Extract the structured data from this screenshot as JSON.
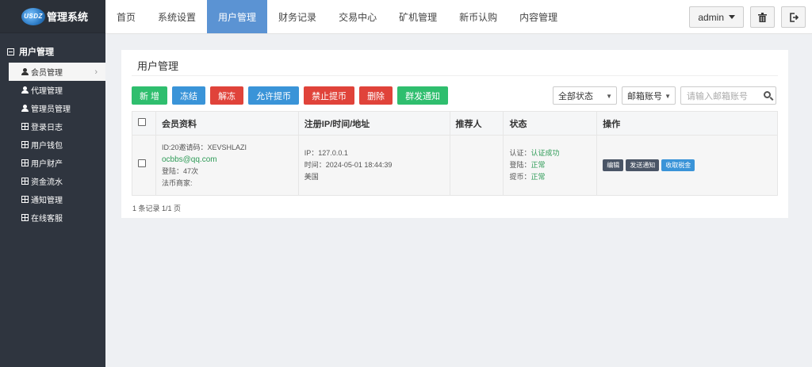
{
  "app": {
    "logo_badge": "USDZ",
    "title": "管理系统"
  },
  "sidebar": {
    "section": "用户管理",
    "items": [
      {
        "label": "会员管理",
        "icon": "person-icon",
        "active": true
      },
      {
        "label": "代理管理",
        "icon": "person-icon"
      },
      {
        "label": "管理员管理",
        "icon": "person-icon"
      },
      {
        "label": "登录日志",
        "icon": "list-icon"
      },
      {
        "label": "用户钱包",
        "icon": "list-icon"
      },
      {
        "label": "用户财产",
        "icon": "list-icon"
      },
      {
        "label": "资金流水",
        "icon": "list-icon"
      },
      {
        "label": "通知管理",
        "icon": "list-icon"
      },
      {
        "label": "在线客服",
        "icon": "list-icon"
      }
    ]
  },
  "topnav": {
    "tabs": [
      "首页",
      "系统设置",
      "用户管理",
      "财务记录",
      "交易中心",
      "矿机管理",
      "新币认购",
      "内容管理"
    ],
    "active_tab": "用户管理",
    "user": "admin"
  },
  "panel": {
    "title": "用户管理",
    "toolbar": {
      "add": "新 增",
      "freeze": "冻结",
      "unfreeze": "解冻",
      "allow_withdraw": "允许提币",
      "forbid_withdraw": "禁止提币",
      "delete": "删除",
      "broadcast": "群发通知"
    },
    "filters": {
      "status": "全部状态",
      "account_type": "邮箱账号",
      "search_placeholder": "请输入邮箱账号"
    },
    "table": {
      "headers": [
        "会员资料",
        "注册IP/时间/地址",
        "推荐人",
        "状态",
        "操作"
      ],
      "rows": [
        {
          "profile_id": "ID:20邀请码：XEVSHLAZI",
          "email": "ocbbs@qq.com",
          "logins": "登陆：47次",
          "otc": "法币商家:",
          "ip": "IP：127.0.0.1",
          "time": "时间：2024-05-01 18:44:39",
          "location": "美国",
          "referrer": "",
          "status_auth_label": "认证：",
          "status_auth_value": "认证成功",
          "status_login_label": "登陆：",
          "status_login_value": "正常",
          "status_withdraw_label": "提币：",
          "status_withdraw_value": "正常",
          "actions": [
            "编辑",
            "发送通知",
            "收取税金"
          ]
        }
      ]
    },
    "pager": "1 条记录 1/1 页"
  },
  "colors": {
    "sidebar_bg": "#2f353f",
    "nav_active": "#5b93d3",
    "green": "#2fbe6e",
    "blue": "#3a94d8",
    "red": "#e0433a"
  }
}
